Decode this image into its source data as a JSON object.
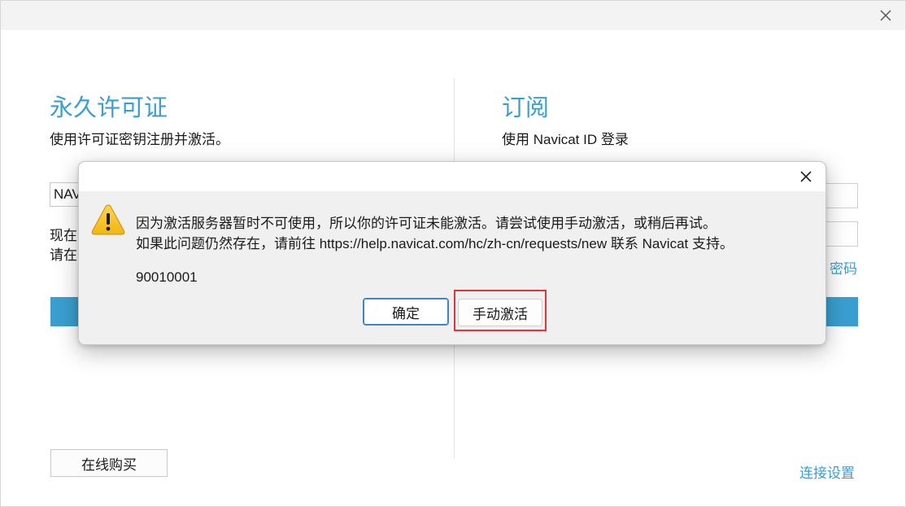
{
  "perpetual": {
    "title": "永久许可证",
    "description": "使用许可证密钥注册并激活。",
    "key_value": "NAV",
    "hint_line1": "现在",
    "hint_line2": "请在",
    "buy_label": "在线购买"
  },
  "subscription": {
    "title": "订阅",
    "description": "使用 Navicat ID 登录",
    "forgot_link_partial": "密码",
    "connection_settings": "连接设置"
  },
  "dialog": {
    "message_line1": "因为激活服务器暂时不可使用，所以你的许可证未能激活。请尝试使用手动激活，或稍后再试。",
    "message_line2": "如果此问题仍然存在，请前往 https://help.navicat.com/hc/zh-cn/requests/new 联系 Navicat 支持。",
    "error_code": "90010001",
    "ok_label": "确定",
    "manual_label": "手动激活"
  },
  "colors": {
    "accent": "#3a9fd0",
    "highlight": "#e0353b",
    "warning": "#f7c12a"
  }
}
